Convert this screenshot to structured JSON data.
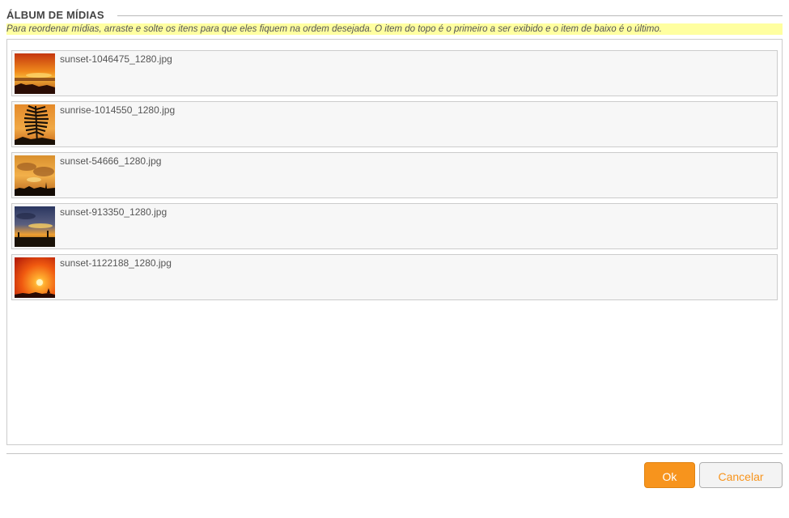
{
  "header": {
    "title": "ÁLBUM DE MÍDIAS",
    "hint": "Para reordenar mídias, arraste e solte os itens para que eles fiquem na ordem desejada. O item do topo é o primeiro a ser exibido e o item de baixo é o último."
  },
  "media_items": [
    {
      "filename": "sunset-1046475_1280.jpg",
      "thumb_icon": "sunset-thumbnail"
    },
    {
      "filename": "sunrise-1014550_1280.jpg",
      "thumb_icon": "sunrise-fern-thumbnail"
    },
    {
      "filename": "sunset-54666_1280.jpg",
      "thumb_icon": "sunset-clouds-thumbnail"
    },
    {
      "filename": "sunset-913350_1280.jpg",
      "thumb_icon": "sunset-sky-thumbnail"
    },
    {
      "filename": "sunset-1122188_1280.jpg",
      "thumb_icon": "sunset-sun-thumbnail"
    }
  ],
  "footer": {
    "ok_label": "Ok",
    "cancel_label": "Cancelar"
  },
  "colors": {
    "accent": "#f7941d",
    "hint_background": "#ffffa0",
    "title_text": "#444444"
  }
}
